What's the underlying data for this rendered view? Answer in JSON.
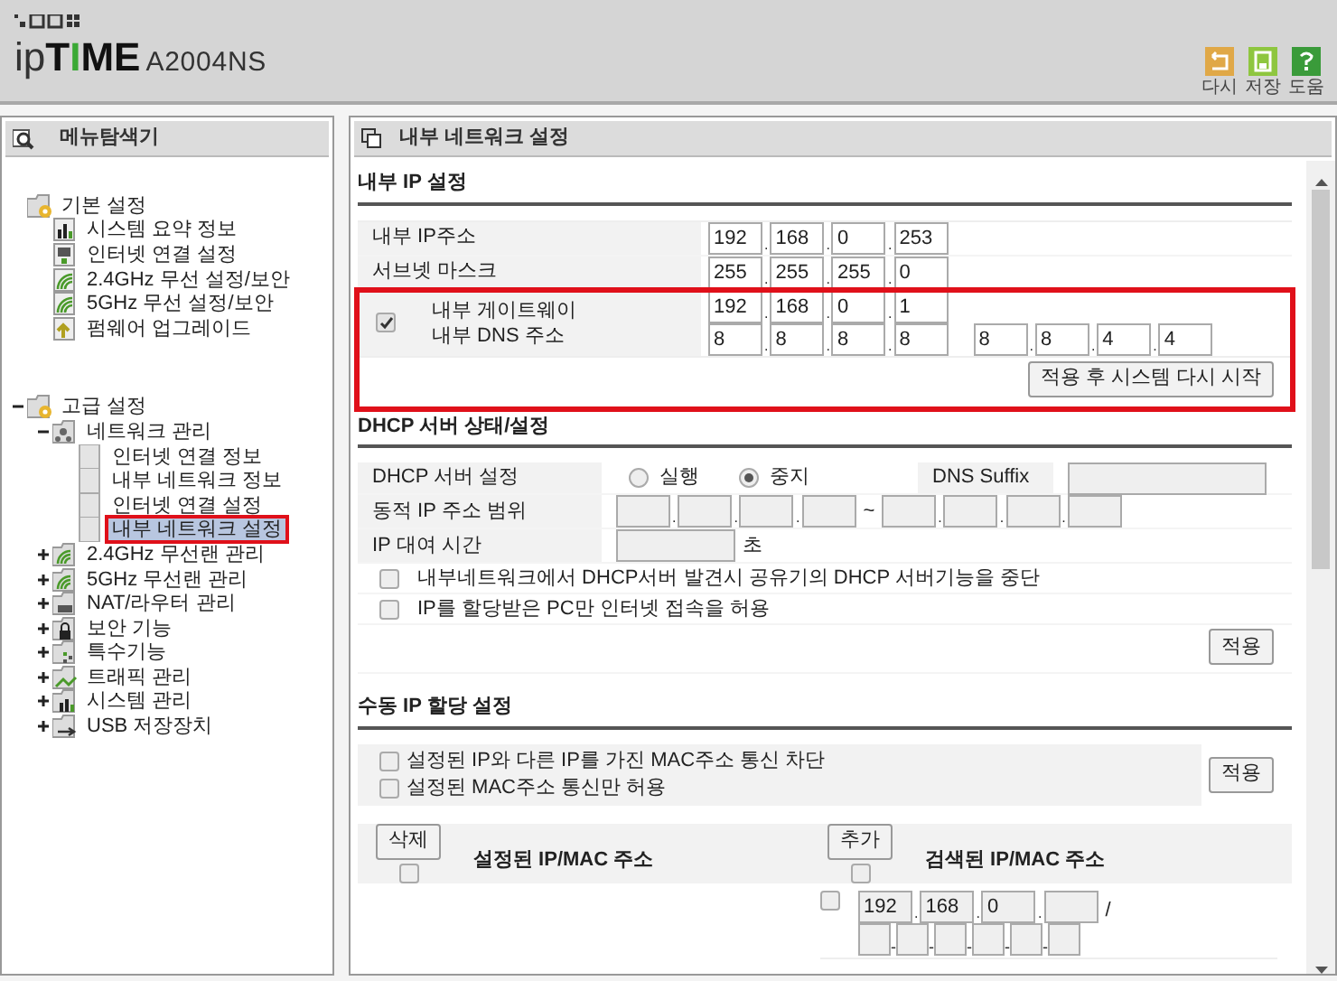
{
  "header": {
    "logo": [
      {
        "text": "ip",
        "kind": "light"
      },
      {
        "text": "T",
        "kind": "bold"
      },
      {
        "text": "I",
        "kind": "accent"
      },
      {
        "text": "ME",
        "kind": "bold"
      }
    ],
    "model": "A2004NS",
    "toolbar": [
      {
        "label": "다시",
        "kind": "undo"
      },
      {
        "label": "저장",
        "kind": "save"
      },
      {
        "label": "도움",
        "kind": "help"
      }
    ]
  },
  "sidebar": {
    "title": "메뉴탐색기",
    "tree": [
      {
        "label": "기본 설정",
        "kind": "folder-gear",
        "selected": false,
        "marked": false,
        "children": [
          {
            "label": "시스템 요약 정보",
            "kind": "chart",
            "selected": false,
            "marked": false
          },
          {
            "label": "인터넷 연결 설정",
            "kind": "monitor",
            "selected": false,
            "marked": false
          },
          {
            "label": "2.4GHz 무선 설정/보안",
            "kind": "wifi",
            "selected": false,
            "marked": false
          },
          {
            "label": "5GHz 무선 설정/보안",
            "kind": "wifi",
            "selected": false,
            "marked": false
          },
          {
            "label": "펌웨어 업그레이드",
            "kind": "upload",
            "selected": false,
            "marked": false
          }
        ]
      },
      {
        "label": "고급 설정",
        "kind": "folder-gear",
        "expanded": true,
        "selected": false,
        "marked": false,
        "children": [
          {
            "label": "네트워크 관리",
            "kind": "folder-network",
            "expanded": true,
            "selected": false,
            "marked": false,
            "children": [
              {
                "label": "인터넷 연결 정보",
                "kind": "page",
                "selected": false,
                "marked": false
              },
              {
                "label": "내부 네트워크 정보",
                "kind": "page",
                "selected": false,
                "marked": false
              },
              {
                "label": "인터넷 연결 설정",
                "kind": "page",
                "selected": false,
                "marked": false
              },
              {
                "label": "내부 네트워크 설정",
                "kind": "page",
                "selected": true,
                "marked": true
              }
            ]
          },
          {
            "label": "2.4GHz 무선랜 관리",
            "kind": "folder-wifi",
            "expanded": false,
            "selected": false,
            "marked": false
          },
          {
            "label": "5GHz 무선랜 관리",
            "kind": "folder-wifi",
            "expanded": false,
            "selected": false,
            "marked": false
          },
          {
            "label": "NAT/라우터 관리",
            "kind": "folder-router",
            "expanded": false,
            "selected": false,
            "marked": false
          },
          {
            "label": "보안 기능",
            "kind": "folder-lock",
            "expanded": false,
            "selected": false,
            "marked": false
          },
          {
            "label": "특수기능",
            "kind": "folder-special",
            "expanded": false,
            "selected": false,
            "marked": false
          },
          {
            "label": "트래픽 관리",
            "kind": "folder-traffic",
            "expanded": false,
            "selected": false,
            "marked": false
          },
          {
            "label": "시스템 관리",
            "kind": "folder-chart",
            "expanded": false,
            "selected": false,
            "marked": false
          },
          {
            "label": "USB 저장장치",
            "kind": "folder-usb",
            "expanded": false,
            "selected": false,
            "marked": false
          }
        ]
      }
    ]
  },
  "main": {
    "title": "내부 네트워크 설정",
    "ip_separator": ".",
    "mac_separator": "-",
    "range_separator": "~",
    "pair_separator": "/",
    "ip_section": {
      "heading": "내부 IP 설정",
      "rows": [
        {
          "label": "내부 IP주소",
          "octets": [
            "192",
            "168",
            "0",
            "253"
          ]
        },
        {
          "label": "서브넷 마스크",
          "octets": [
            "255",
            "255",
            "255",
            "0"
          ]
        }
      ],
      "gateway": {
        "checked": true,
        "marked": true,
        "gateway_label": "내부 게이트웨이",
        "dns_label": "내부 DNS 주소",
        "gateway": [
          "192",
          "168",
          "0",
          "1"
        ],
        "dns1": [
          "8",
          "8",
          "8",
          "8"
        ],
        "dns2": [
          "8",
          "8",
          "4",
          "4"
        ],
        "button": "적용 후 시스템 다시 시작"
      }
    },
    "dhcp": {
      "heading": "DHCP 서버 상태/설정",
      "server_label": "DHCP 서버 설정",
      "disabled": true,
      "options": [
        {
          "label": "실행",
          "selected": false
        },
        {
          "label": "중지",
          "selected": true
        }
      ],
      "suffix_label": "DNS Suffix",
      "range_label": "동적 IP 주소 범위",
      "lease_label": "IP 대여 시간",
      "lease_unit": "초",
      "checks": [
        {
          "label": "내부네트워크에서 DHCP서버 발견시 공유기의 DHCP 서버기능을 중단",
          "checked": false
        },
        {
          "label": "IP를 할당받은 PC만 인터넷 접속을 허용",
          "checked": false
        }
      ],
      "button": "적용"
    },
    "manual": {
      "heading": "수동 IP 할당 설정",
      "checks": [
        {
          "label": "설정된 IP와 다른 IP를 가진 MAC주소 통신 차단",
          "checked": false
        },
        {
          "label": "설정된 MAC주소 통신만 허용",
          "checked": false
        }
      ],
      "button": "적용",
      "configured": {
        "button": "삭제",
        "title": "설정된 IP/MAC 주소",
        "checked": false
      },
      "found": {
        "button": "추가",
        "title": "검색된 IP/MAC 주소",
        "checked": false,
        "rows": [
          {
            "checked": false,
            "octets": [
              "192",
              "168",
              "0"
            ]
          }
        ]
      }
    }
  }
}
